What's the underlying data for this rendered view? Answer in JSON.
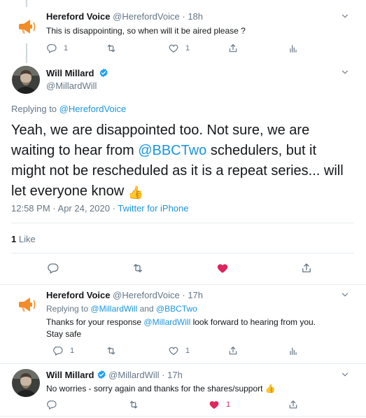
{
  "tweet1": {
    "display_name": "Hereford Voice",
    "handle": "@HerefordVoice",
    "time": "18h",
    "text": "This is disappointing, so when will it be aired please ?",
    "reply_count": "1",
    "like_count": "1"
  },
  "main_tweet": {
    "display_name": "Will Millard",
    "handle": "@MillardWill",
    "replying_label": "Replying to",
    "replying_to": "@HerefordVoice",
    "text_part1": "Yeah, we are disappointed too. Not sure, we are waiting to hear from ",
    "mention": "@BBCTwo",
    "text_part2": " schedulers, but it might not be rescheduled as it is a repeat series... will let everyone know",
    "emoji": "👍",
    "time": "12:58 PM",
    "separator": "·",
    "date": "Apr 24, 2020",
    "source": "Twitter for iPhone",
    "likes_count": "1",
    "likes_label": "Like",
    "liked": true,
    "heart_color": "#e0245e"
  },
  "tweet3": {
    "display_name": "Hereford Voice",
    "handle": "@HerefordVoice",
    "time": "17h",
    "replying_label": "Replying to",
    "replying_to_1": "@MillardWill",
    "replying_and": "and",
    "replying_to_2": "@BBCTwo",
    "text_part1": "Thanks for your response ",
    "mention": "@MillardWill",
    "text_part2": " look forward to hearing from you.",
    "text_line2": "Stay safe",
    "reply_count": "1",
    "like_count": "1"
  },
  "tweet4": {
    "display_name": "Will Millard",
    "handle": "@MillardWill",
    "time": "17h",
    "text": "No worries - sorry again and thanks for the shares/support",
    "emoji": "👍",
    "like_count": "1"
  },
  "colors": {
    "link": "#1b95e0",
    "muted": "#657786",
    "text": "#14171a",
    "verified": "#1da1f2",
    "like_red": "#e0245e",
    "megaphone_orange": "#f28c28"
  },
  "separator": "·"
}
